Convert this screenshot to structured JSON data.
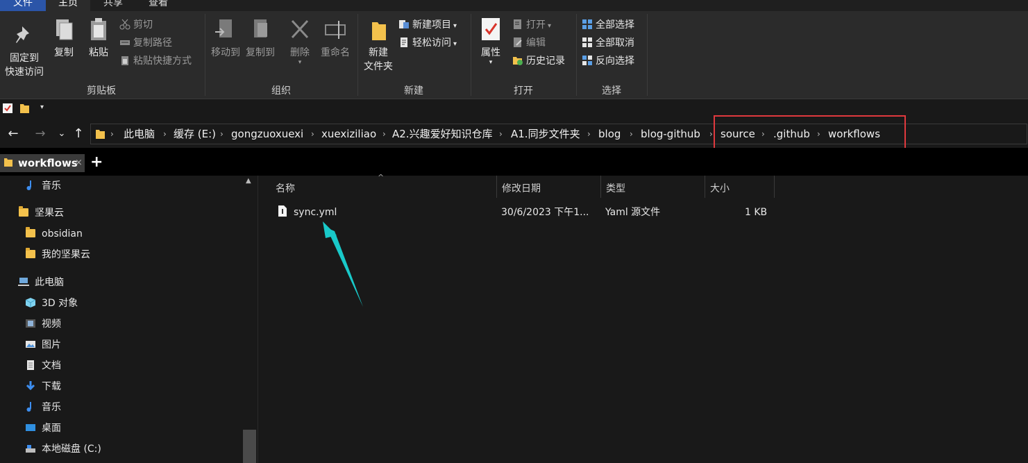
{
  "menu": {
    "file": "文件",
    "home": "主页",
    "share": "共享",
    "view": "查看"
  },
  "ribbon": {
    "clipboard": {
      "pin_line1": "固定到",
      "pin_line2": "快速访问",
      "copy": "复制",
      "paste": "粘贴",
      "cut": "剪切",
      "copy_path": "复制路径",
      "paste_shortcut": "粘贴快捷方式",
      "group_label": "剪贴板"
    },
    "organize": {
      "move_to": "移动到",
      "copy_to": "复制到",
      "delete": "删除",
      "rename": "重命名",
      "group_label": "组织"
    },
    "new": {
      "new_folder_line1": "新建",
      "new_folder_line2": "文件夹",
      "new_item": "新建项目",
      "easy_access": "轻松访问",
      "group_label": "新建"
    },
    "open": {
      "properties": "属性",
      "open": "打开",
      "edit": "编辑",
      "history": "历史记录",
      "group_label": "打开"
    },
    "select": {
      "select_all": "全部选择",
      "select_none": "全部取消",
      "invert": "反向选择",
      "group_label": "选择"
    }
  },
  "breadcrumb": [
    "此电脑",
    "缓存 (E:)",
    "gongzuoxuexi",
    "xuexiziliao",
    "A2.兴趣爱好知识仓库",
    "A1.同步文件夹",
    "blog",
    "blog-github",
    "source",
    ".github",
    "workflows"
  ],
  "tab": {
    "label": "workflows",
    "close": "×",
    "new": "+"
  },
  "navpane": {
    "items": [
      {
        "label": "音乐",
        "icon": "music-icon"
      },
      {
        "label": "坚果云",
        "icon": "folder-icon"
      },
      {
        "label": "obsidian",
        "icon": "folder-icon"
      },
      {
        "label": "我的坚果云",
        "icon": "folder-icon"
      },
      {
        "label": "此电脑",
        "icon": "computer-icon"
      },
      {
        "label": "3D 对象",
        "icon": "cube-icon"
      },
      {
        "label": "视频",
        "icon": "video-icon"
      },
      {
        "label": "图片",
        "icon": "picture-icon"
      },
      {
        "label": "文档",
        "icon": "document-icon"
      },
      {
        "label": "下载",
        "icon": "download-icon"
      },
      {
        "label": "音乐",
        "icon": "music-icon"
      },
      {
        "label": "桌面",
        "icon": "desktop-icon"
      },
      {
        "label": "本地磁盘 (C:)",
        "icon": "drive-icon"
      }
    ]
  },
  "columns": {
    "name": "名称",
    "modified": "修改日期",
    "type": "类型",
    "size": "大小"
  },
  "files": [
    {
      "name": "sync.yml",
      "modified": "30/6/2023 下午1...",
      "type": "Yaml 源文件",
      "size": "1 KB"
    }
  ],
  "colors": {
    "highlight_box": "#e0393e",
    "annotation_arrow": "#19c9c9",
    "folder": "#f3c14c",
    "accent": "#2b55a8"
  }
}
